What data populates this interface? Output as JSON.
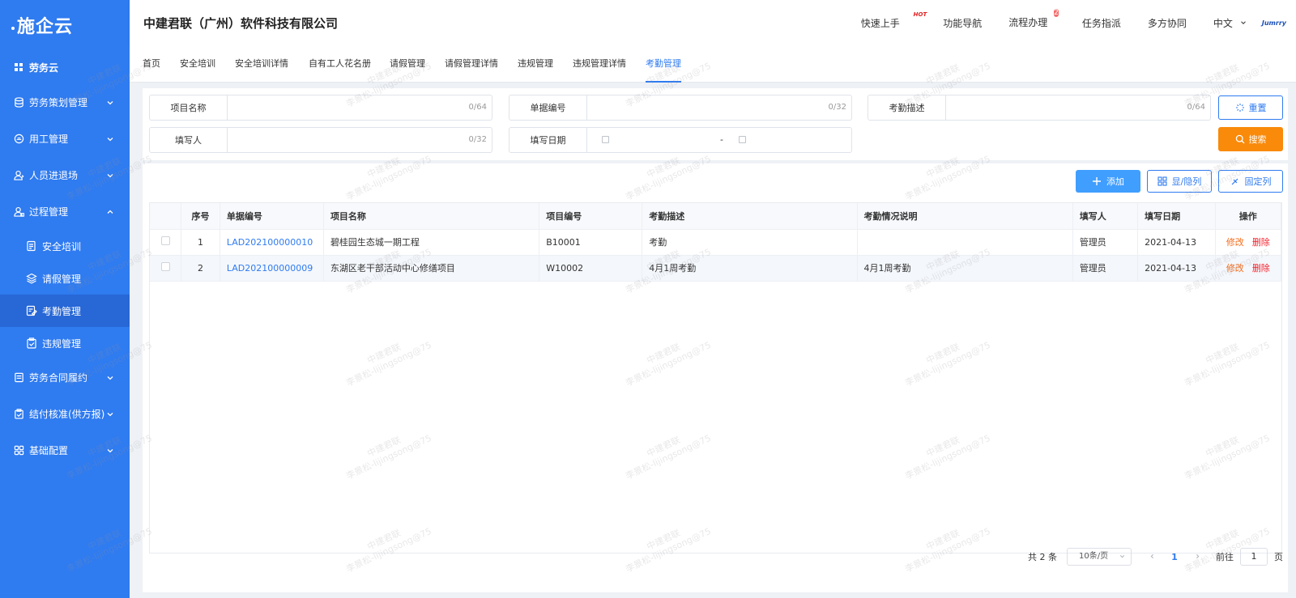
{
  "sidebar": {
    "logo": "施企云",
    "top_item": "劳务云",
    "items": [
      {
        "label": "劳务策划管理"
      },
      {
        "label": "用工管理"
      },
      {
        "label": "人员进退场"
      },
      {
        "label": "过程管理"
      }
    ],
    "sub_items": [
      {
        "label": "安全培训"
      },
      {
        "label": "请假管理"
      },
      {
        "label": "考勤管理"
      },
      {
        "label": "违规管理"
      }
    ],
    "items_after": [
      {
        "label": "劳务合同履约"
      },
      {
        "label": "结付核准(供方报)"
      },
      {
        "label": "基础配置"
      }
    ]
  },
  "header": {
    "company": "中建君联（广州）软件科技有限公司",
    "nav": [
      "快速上手",
      "功能导航",
      "流程办理",
      "任务指派",
      "多方协同"
    ],
    "hot_tag": "HOT",
    "badge_count": "2",
    "language": "中文",
    "brand": "Jumrry"
  },
  "tabs": [
    "首页",
    "安全培训",
    "安全培训详情",
    "自有工人花名册",
    "请假管理",
    "请假管理详情",
    "违规管理",
    "违规管理详情",
    "考勤管理"
  ],
  "filter": {
    "project_name_label": "项目名称",
    "project_name_count": "0/64",
    "doc_no_label": "单据编号",
    "doc_no_count": "0/32",
    "attendance_desc_label": "考勤描述",
    "attendance_desc_count": "0/64",
    "filler_label": "填写人",
    "filler_count": "0/32",
    "fill_date_label": "填写日期",
    "date_separator": "-",
    "reset_label": "重置",
    "search_label": "搜索"
  },
  "toolbar": {
    "add_label": "添加",
    "toggle_columns_label": "显/隐列",
    "fix_columns_label": "固定列"
  },
  "table": {
    "columns": [
      "序号",
      "单据编号",
      "项目名称",
      "项目编号",
      "考勤描述",
      "考勤情况说明",
      "填写人",
      "填写日期",
      "操作"
    ],
    "rows": [
      {
        "seq": "1",
        "doc_no": "LAD202100000010",
        "project_name": "碧桂园生态城一期工程",
        "project_no": "B10001",
        "desc": "考勤",
        "note": "",
        "filler": "管理员",
        "date": "2021-04-13",
        "edit": "修改",
        "delete": "删除"
      },
      {
        "seq": "2",
        "doc_no": "LAD202100000009",
        "project_name": "东湖区老干部活动中心修缮项目",
        "project_no": "W10002",
        "desc": "4月1周考勤",
        "note": "4月1周考勤",
        "filler": "管理员",
        "date": "2021-04-13",
        "edit": "修改",
        "delete": "删除"
      }
    ]
  },
  "pagination": {
    "total": "共 2 条",
    "page_size": "10条/页",
    "current_page": "1",
    "goto_label": "前往",
    "goto_value": "1",
    "page_unit": "页"
  },
  "watermark": {
    "line1": "中建君联",
    "line2": "李景松-lijingsong@75"
  },
  "colors": {
    "sidebar": "#2f7bf0",
    "primary": "#2f7bf0",
    "search_button": "#f98a0a",
    "edit_link": "#f56c1a",
    "delete_link": "#f5222d"
  }
}
